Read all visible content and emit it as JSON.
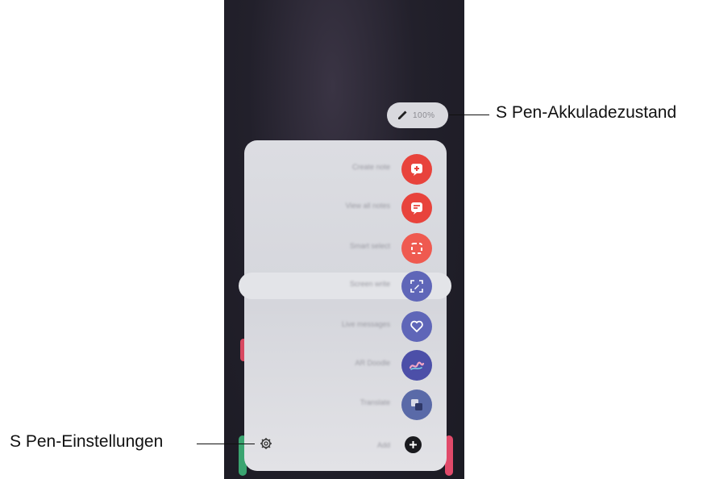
{
  "callouts": {
    "battery_status": "S Pen-Akkuladezustand",
    "settings": "S Pen-Einstellungen"
  },
  "battery_pill": {
    "level_text": "100%"
  },
  "menu": {
    "items": [
      {
        "label": "Create note",
        "icon": "create-note-icon",
        "color": "#e8433c"
      },
      {
        "label": "View all notes",
        "icon": "view-all-notes-icon",
        "color": "#e8433c"
      },
      {
        "label": "Smart select",
        "icon": "smart-select-icon",
        "color": "#ef5a50"
      },
      {
        "label": "Screen write",
        "icon": "screen-write-icon",
        "color": "#5f66b8"
      },
      {
        "label": "Live messages",
        "icon": "live-messages-icon",
        "color": "#5f66b8"
      },
      {
        "label": "AR Doodle",
        "icon": "ar-doodle-icon",
        "color": "#4c4fa8"
      },
      {
        "label": "Translate",
        "icon": "translate-icon",
        "color": "#5a6aa8"
      }
    ],
    "add_label": "Add"
  }
}
